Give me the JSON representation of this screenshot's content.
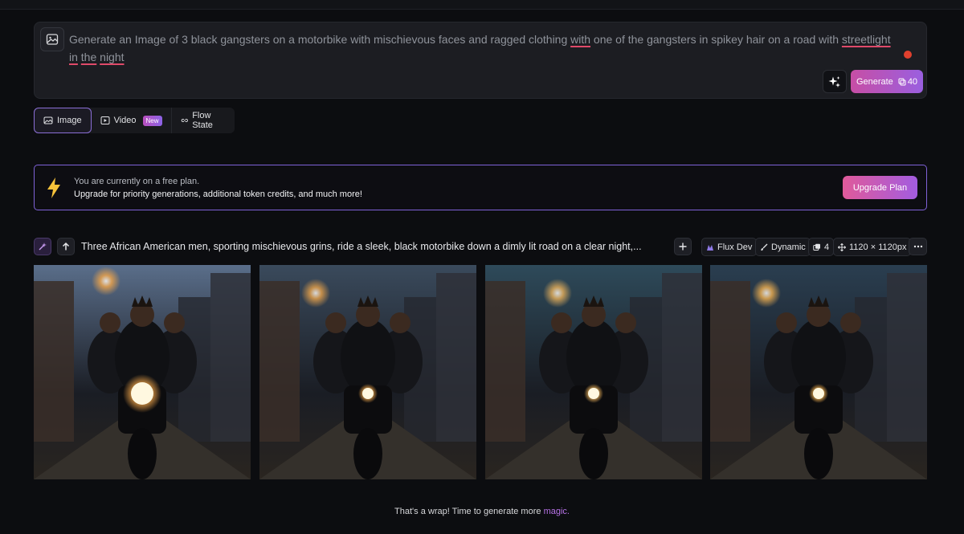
{
  "prompt": {
    "text_parts": [
      {
        "t": "Generate an Image of 3 black gangsters on a motorbike with mischievous faces and ragged clothing "
      },
      {
        "t": "with",
        "spell": true
      },
      {
        "t": " one of the gangsters in spikey hair on a road with "
      },
      {
        "t": "streetlight",
        "spell": true
      },
      {
        "t": " "
      },
      {
        "t": "in",
        "spell": true
      },
      {
        "t": " "
      },
      {
        "t": "the",
        "spell": true
      },
      {
        "t": " "
      },
      {
        "t": "night",
        "spell": true
      }
    ],
    "generate_label": "Generate",
    "token_cost": "40"
  },
  "modes": {
    "image": "Image",
    "video": "Video",
    "new_badge": "New",
    "flow": "Flow State"
  },
  "banner": {
    "line1": "You are currently on a free plan.",
    "line2": "Upgrade for priority generations, additional token credits, and much more!",
    "button": "Upgrade Plan"
  },
  "generation": {
    "prompt": "Three African American men, sporting mischievous grins, ride a sleek, black motorbike down a dimly lit road on a clear night,...",
    "model": "Flux Dev",
    "style": "Dynamic",
    "count": "4",
    "size": "1120 × 1120px"
  },
  "images": [
    {
      "name": "generated-image-1",
      "sky": "#5a6e8a",
      "glow": "#f2a64a"
    },
    {
      "name": "generated-image-2",
      "sky": "#3a4a5c",
      "glow": "#e8a24a"
    },
    {
      "name": "generated-image-3",
      "sky": "#2e4a5a",
      "glow": "#e8b05a"
    },
    {
      "name": "generated-image-4",
      "sky": "#2a3e50",
      "glow": "#f0b050"
    }
  ],
  "footer": {
    "text": "That's a wrap! Time to generate more ",
    "magic": "magic."
  },
  "colors": {
    "accent": "#8b6fd6",
    "generate_gradient_start": "#c74ea5",
    "generate_gradient_end": "#9a5fe0",
    "spell_underline": "#e04a6a"
  }
}
